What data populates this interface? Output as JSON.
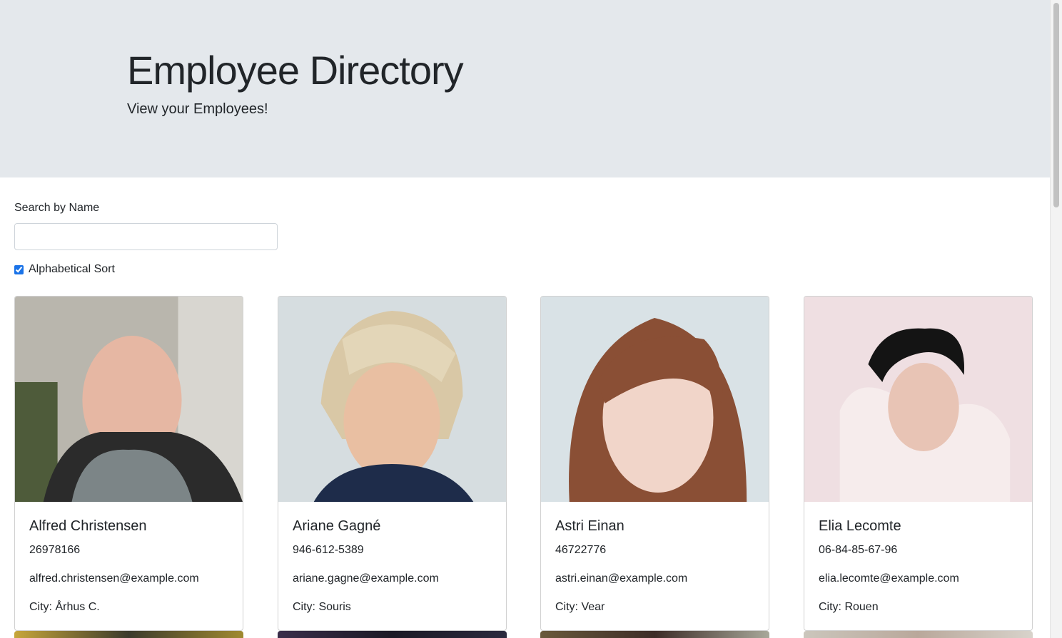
{
  "header": {
    "title": "Employee Directory",
    "subtitle": "View your Employees!"
  },
  "search": {
    "label": "Search by Name",
    "value": "",
    "placeholder": ""
  },
  "sort": {
    "label": "Alphabetical Sort",
    "checked": true
  },
  "employees": [
    {
      "name": "Alfred Christensen",
      "phone": "26978166",
      "email": "alfred.christensen@example.com",
      "city": "City: Århus C."
    },
    {
      "name": "Ariane Gagné",
      "phone": "946-612-5389",
      "email": "ariane.gagne@example.com",
      "city": "City: Souris"
    },
    {
      "name": "Astri Einan",
      "phone": "46722776",
      "email": "astri.einan@example.com",
      "city": "City: Vear"
    },
    {
      "name": "Elia Lecomte",
      "phone": "06-84-85-67-96",
      "email": "elia.lecomte@example.com",
      "city": "City: Rouen"
    }
  ],
  "colors": {
    "jumbotron_bg": "#e4e8ec",
    "checkbox_accent": "#1a73e8"
  }
}
